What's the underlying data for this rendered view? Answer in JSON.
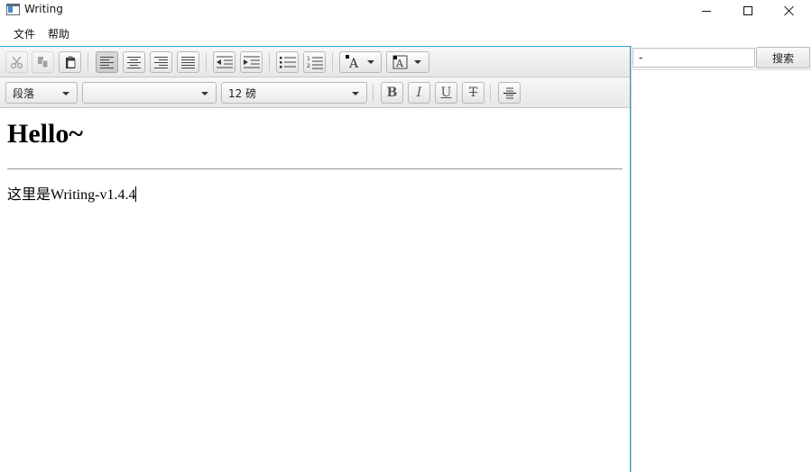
{
  "window": {
    "title": "Writing",
    "icon": "app-window-icon"
  },
  "menu": {
    "items": [
      {
        "label": "文件"
      },
      {
        "label": "帮助"
      }
    ]
  },
  "toolbar1": {
    "buttons": [
      {
        "name": "cut",
        "icon": "scissors-icon",
        "enabled": false
      },
      {
        "name": "copy",
        "icon": "copy-icon",
        "enabled": false
      },
      {
        "name": "paste",
        "icon": "clipboard-icon",
        "enabled": true
      },
      {
        "name": "align-left",
        "icon": "align-left-icon",
        "selected": true
      },
      {
        "name": "align-center",
        "icon": "align-center-icon"
      },
      {
        "name": "align-right",
        "icon": "align-right-icon"
      },
      {
        "name": "align-justify",
        "icon": "align-justify-icon"
      },
      {
        "name": "outdent",
        "icon": "outdent-icon"
      },
      {
        "name": "indent",
        "icon": "indent-icon"
      },
      {
        "name": "bullet-list",
        "icon": "bullet-list-icon"
      },
      {
        "name": "numbered-list",
        "icon": "numbered-list-icon"
      },
      {
        "name": "text-color",
        "icon": "text-color-icon"
      },
      {
        "name": "background-color",
        "icon": "background-color-icon"
      }
    ]
  },
  "toolbar2": {
    "paragraph_style": "段落",
    "font_family": "",
    "font_size": "12 磅",
    "bold_label": "B",
    "italic_label": "I",
    "underline_label": "U",
    "strikethrough_label": "T"
  },
  "document": {
    "heading": "Hello~",
    "body": "这里是Writing-v1.4.4"
  },
  "search": {
    "value": "-",
    "button_label": "搜索"
  },
  "colors": {
    "focus_border": "#2aa0d8",
    "toolbar_top": "#f7f7f7",
    "toolbar_bottom": "#e7e7e7"
  }
}
